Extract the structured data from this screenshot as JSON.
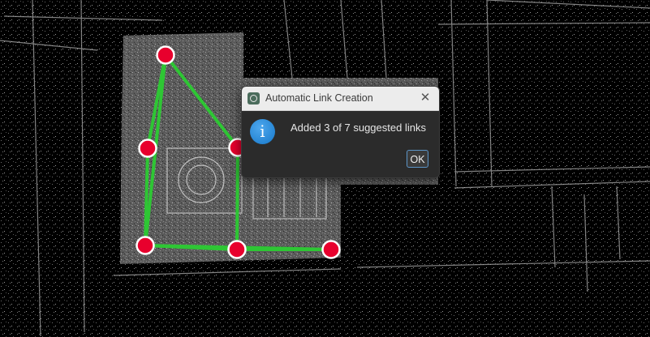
{
  "dialog": {
    "title": "Automatic Link Creation",
    "message": "Added 3 of 7 suggested links",
    "ok_label": "OK",
    "close_glyph": "✕",
    "info_glyph": "i",
    "icons": [
      "app-icon",
      "close-icon",
      "info-icon"
    ]
  },
  "viewport": {
    "node_color": "#e8002d",
    "link_color": "#2ec634",
    "node_count": 7,
    "link_count": 8
  }
}
